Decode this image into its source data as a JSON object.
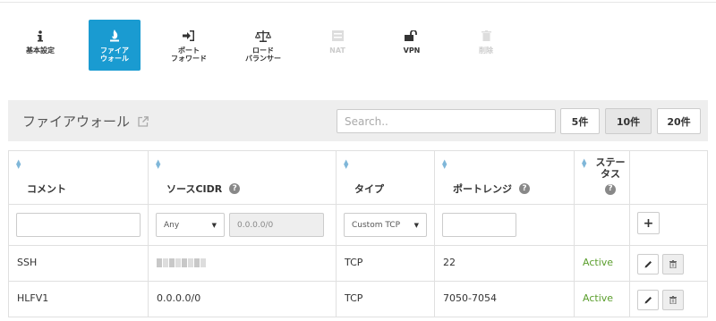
{
  "toolbar": {
    "items": [
      {
        "label": "基本設定",
        "icon": "info-icon"
      },
      {
        "label": "ファイア\nウォール",
        "icon": "fire-icon",
        "active": true
      },
      {
        "label": "ポート\nフォワード",
        "icon": "sign-in-icon"
      },
      {
        "label": "ロード\nバランサー",
        "icon": "balance-scale-icon"
      },
      {
        "label": "NAT",
        "icon": "nat-icon",
        "disabled": true
      },
      {
        "label": "VPN",
        "icon": "unlock-icon"
      },
      {
        "label": "削除",
        "icon": "trash-icon",
        "disabled": true
      }
    ]
  },
  "header": {
    "title": "ファイアウォール",
    "search_placeholder": "Search..",
    "page_sizes": [
      "5件",
      "10件",
      "20件"
    ],
    "selected_page_size": "10件"
  },
  "table": {
    "columns": {
      "comment": "コメント",
      "source_cidr": "ソースCIDR",
      "type": "タイプ",
      "port_range": "ポートレンジ",
      "status_line1": "ステー",
      "status_line2": "タス"
    },
    "filter": {
      "source_select": "Any",
      "source_cidr_placeholder": "0.0.0.0/0",
      "type_select": "Custom TCP",
      "add_label": "+"
    },
    "rows": [
      {
        "comment": "SSH",
        "source": "",
        "type": "TCP",
        "port_range": "22",
        "status": "Active"
      },
      {
        "comment": "HLFV1",
        "source": "0.0.0.0/0",
        "type": "TCP",
        "port_range": "7050-7054",
        "status": "Active"
      }
    ]
  },
  "colors": {
    "accent": "#1a9bd1",
    "active_status": "#5a9e2c"
  }
}
